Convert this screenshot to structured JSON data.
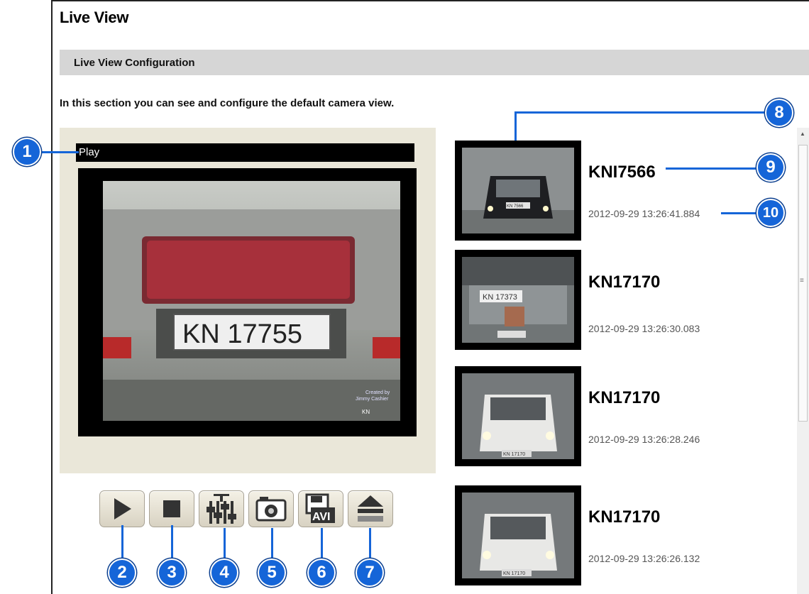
{
  "page": {
    "title": "Live View",
    "section_title": "Live View Configuration",
    "intro": "In this section you can see and configure the default camera view."
  },
  "player": {
    "status": "Play",
    "plate_main": "KN 17755",
    "overlay_lines": [
      "Created by",
      "Jimmy Cashier",
      "KN"
    ]
  },
  "controls": [
    {
      "name": "play",
      "icon": "play-icon"
    },
    {
      "name": "stop",
      "icon": "stop-icon"
    },
    {
      "name": "settings",
      "icon": "equalizer-icon"
    },
    {
      "name": "snapshot",
      "icon": "camera-icon"
    },
    {
      "name": "record-avi",
      "icon": "save-avi-icon",
      "label": "AVI"
    },
    {
      "name": "export",
      "icon": "eject-icon"
    }
  ],
  "recognitions": [
    {
      "plate": "KNI7566",
      "timestamp": "2012-09-29 13:26:41.884",
      "thumb_plate": "KN 7566"
    },
    {
      "plate": "KN17170",
      "timestamp": "2012-09-29 13:26:30.083",
      "thumb_plate": "KN 17373"
    },
    {
      "plate": "KN17170",
      "timestamp": "2012-09-29 13:26:28.246",
      "thumb_plate": "KN 17170"
    },
    {
      "plate": "KN17170",
      "timestamp": "2012-09-29 13:26:26.132",
      "thumb_plate": "KN 17170"
    }
  ],
  "callouts": [
    "1",
    "2",
    "3",
    "4",
    "5",
    "6",
    "7",
    "8",
    "9",
    "10"
  ],
  "colors": {
    "callout": "#1565d8",
    "panel": "#eae7d9",
    "bar": "#d6d6d6"
  }
}
